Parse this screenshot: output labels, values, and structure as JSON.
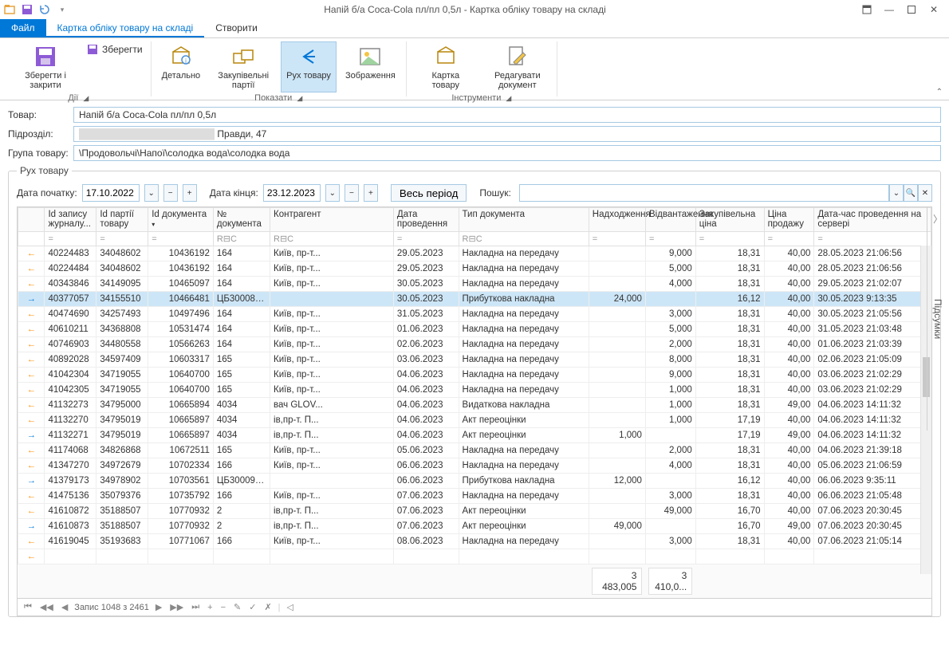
{
  "title": "Напій б/а Coca-Cola пл/пл 0,5л - Картка обліку товару на складі",
  "tabs": {
    "file": "Файл",
    "card": "Картка обліку товару на складі",
    "create": "Створити"
  },
  "ribbon": {
    "actions": {
      "label": "Дії",
      "save_close": "Зберегти і закрити",
      "save": "Зберегти"
    },
    "show": {
      "label": "Показати",
      "detail": "Детально",
      "batches": "Закупівельні партії",
      "movement": "Рух товару",
      "image": "Зображення"
    },
    "tools": {
      "label": "Інструменти",
      "card": "Картка товару",
      "edit": "Редагувати документ"
    }
  },
  "form": {
    "product_label": "Товар:",
    "product_value": "Напій б/а Coca-Cola пл/пл 0,5л",
    "division_label": "Підрозділ:",
    "division_value": "Правди, 47",
    "group_label": "Група товару:",
    "group_value": "\\Продовольчі\\Напої\\солодка вода\\солодка вода"
  },
  "panel": {
    "title": "Рух товару",
    "date_start_label": "Дата початку:",
    "date_start": "17.10.2022",
    "date_end_label": "Дата кінця:",
    "date_end": "23.12.2023",
    "whole_period": "Весь період",
    "search_label": "Пошук:"
  },
  "columns": [
    "",
    "Id запису журналу...",
    "Id партії товару",
    "Id документа",
    "№ документа",
    "Контрагент",
    "Дата проведення",
    "Тип документа",
    "Надходження",
    "Відвантаження",
    "Закупівельна ціна",
    "Ціна продажу",
    "Дата-час проведення на сервері"
  ],
  "filter_hints": [
    "",
    "=",
    "=",
    "=",
    "R⊟C",
    "R⊟C",
    "=",
    "R⊟C",
    "=",
    "=",
    "=",
    "=",
    "="
  ],
  "rows": [
    {
      "dir": "out",
      "jid": "40224483",
      "bid": "34048602",
      "did": "10436192",
      "dn": "164",
      "ctr": "Київ, пр-т...",
      "date": "29.05.2023",
      "type": "Накладна на передачу",
      "in": "",
      "out": "9,000",
      "pp": "18,31",
      "sp": "40,00",
      "srv": "28.05.2023 21:06:56"
    },
    {
      "dir": "out",
      "jid": "40224484",
      "bid": "34048602",
      "did": "10436192",
      "dn": "164",
      "ctr": "Київ, пр-т...",
      "date": "29.05.2023",
      "type": "Накладна на передачу",
      "in": "",
      "out": "5,000",
      "pp": "18,31",
      "sp": "40,00",
      "srv": "28.05.2023 21:06:56"
    },
    {
      "dir": "out",
      "jid": "40343846",
      "bid": "34149095",
      "did": "10465097",
      "dn": "164",
      "ctr": "Київ, пр-т...",
      "date": "30.05.2023",
      "type": "Накладна на передачу",
      "in": "",
      "out": "4,000",
      "pp": "18,31",
      "sp": "40,00",
      "srv": "29.05.2023 21:02:07"
    },
    {
      "dir": "in",
      "sel": true,
      "jid": "40377057",
      "bid": "34155510",
      "did": "10466481",
      "dn": "ЦБ300087...",
      "ctr": "",
      "date": "30.05.2023",
      "type": "Прибуткова накладна",
      "in": "24,000",
      "out": "",
      "pp": "16,12",
      "sp": "40,00",
      "srv": "30.05.2023 9:13:35"
    },
    {
      "dir": "out",
      "jid": "40474690",
      "bid": "34257493",
      "did": "10497496",
      "dn": "164",
      "ctr": "Київ, пр-т...",
      "date": "31.05.2023",
      "type": "Накладна на передачу",
      "in": "",
      "out": "3,000",
      "pp": "18,31",
      "sp": "40,00",
      "srv": "30.05.2023 21:05:56"
    },
    {
      "dir": "out",
      "jid": "40610211",
      "bid": "34368808",
      "did": "10531474",
      "dn": "164",
      "ctr": "Київ, пр-т...",
      "date": "01.06.2023",
      "type": "Накладна на передачу",
      "in": "",
      "out": "5,000",
      "pp": "18,31",
      "sp": "40,00",
      "srv": "31.05.2023 21:03:48"
    },
    {
      "dir": "out",
      "jid": "40746903",
      "bid": "34480558",
      "did": "10566263",
      "dn": "164",
      "ctr": "Київ, пр-т...",
      "date": "02.06.2023",
      "type": "Накладна на передачу",
      "in": "",
      "out": "2,000",
      "pp": "18,31",
      "sp": "40,00",
      "srv": "01.06.2023 21:03:39"
    },
    {
      "dir": "out",
      "jid": "40892028",
      "bid": "34597409",
      "did": "10603317",
      "dn": "165",
      "ctr": "Київ, пр-т...",
      "date": "03.06.2023",
      "type": "Накладна на передачу",
      "in": "",
      "out": "8,000",
      "pp": "18,31",
      "sp": "40,00",
      "srv": "02.06.2023 21:05:09"
    },
    {
      "dir": "out",
      "jid": "41042304",
      "bid": "34719055",
      "did": "10640700",
      "dn": "165",
      "ctr": "Київ, пр-т...",
      "date": "04.06.2023",
      "type": "Накладна на передачу",
      "in": "",
      "out": "9,000",
      "pp": "18,31",
      "sp": "40,00",
      "srv": "03.06.2023 21:02:29"
    },
    {
      "dir": "out",
      "jid": "41042305",
      "bid": "34719055",
      "did": "10640700",
      "dn": "165",
      "ctr": "Київ, пр-т...",
      "date": "04.06.2023",
      "type": "Накладна на передачу",
      "in": "",
      "out": "1,000",
      "pp": "18,31",
      "sp": "40,00",
      "srv": "03.06.2023 21:02:29"
    },
    {
      "dir": "out",
      "jid": "41132273",
      "bid": "34795000",
      "did": "10665894",
      "dn": "4034",
      "ctr": "вач GLOV...",
      "date": "04.06.2023",
      "type": "Видаткова накладна",
      "in": "",
      "out": "1,000",
      "pp": "18,31",
      "sp": "49,00",
      "srv": "04.06.2023 14:11:32"
    },
    {
      "dir": "out",
      "jid": "41132270",
      "bid": "34795019",
      "did": "10665897",
      "dn": "4034",
      "ctr": "ів,пр-т. П...",
      "date": "04.06.2023",
      "type": "Акт переоцінки",
      "in": "",
      "out": "1,000",
      "pp": "17,19",
      "sp": "40,00",
      "srv": "04.06.2023 14:11:32"
    },
    {
      "dir": "in",
      "jid": "41132271",
      "bid": "34795019",
      "did": "10665897",
      "dn": "4034",
      "ctr": "ів,пр-т. П...",
      "date": "04.06.2023",
      "type": "Акт переоцінки",
      "in": "1,000",
      "out": "",
      "pp": "17,19",
      "sp": "49,00",
      "srv": "04.06.2023 14:11:32"
    },
    {
      "dir": "out",
      "jid": "41174068",
      "bid": "34826868",
      "did": "10672511",
      "dn": "165",
      "ctr": "Київ, пр-т...",
      "date": "05.06.2023",
      "type": "Накладна на передачу",
      "in": "",
      "out": "2,000",
      "pp": "18,31",
      "sp": "40,00",
      "srv": "04.06.2023 21:39:18"
    },
    {
      "dir": "out",
      "jid": "41347270",
      "bid": "34972679",
      "did": "10702334",
      "dn": "166",
      "ctr": "Київ, пр-т...",
      "date": "06.06.2023",
      "type": "Накладна на передачу",
      "in": "",
      "out": "4,000",
      "pp": "18,31",
      "sp": "40,00",
      "srv": "05.06.2023 21:06:59"
    },
    {
      "dir": "in",
      "jid": "41379173",
      "bid": "34978902",
      "did": "10703561",
      "dn": "ЦБ300094...",
      "ctr": "",
      "date": "06.06.2023",
      "type": "Прибуткова накладна",
      "in": "12,000",
      "out": "",
      "pp": "16,12",
      "sp": "40,00",
      "srv": "06.06.2023 9:35:11"
    },
    {
      "dir": "out",
      "jid": "41475136",
      "bid": "35079376",
      "did": "10735792",
      "dn": "166",
      "ctr": "Київ, пр-т...",
      "date": "07.06.2023",
      "type": "Накладна на передачу",
      "in": "",
      "out": "3,000",
      "pp": "18,31",
      "sp": "40,00",
      "srv": "06.06.2023 21:05:48"
    },
    {
      "dir": "out",
      "jid": "41610872",
      "bid": "35188507",
      "did": "10770932",
      "dn": "2",
      "ctr": "ів,пр-т. П...",
      "date": "07.06.2023",
      "type": "Акт переоцінки",
      "in": "",
      "out": "49,000",
      "pp": "16,70",
      "sp": "40,00",
      "srv": "07.06.2023 20:30:45"
    },
    {
      "dir": "in",
      "jid": "41610873",
      "bid": "35188507",
      "did": "10770932",
      "dn": "2",
      "ctr": "ів,пр-т. П...",
      "date": "07.06.2023",
      "type": "Акт переоцінки",
      "in": "49,000",
      "out": "",
      "pp": "16,70",
      "sp": "49,00",
      "srv": "07.06.2023 20:30:45"
    },
    {
      "dir": "out",
      "jid": "41619045",
      "bid": "35193683",
      "did": "10771067",
      "dn": "166",
      "ctr": "Київ, пр-т...",
      "date": "08.06.2023",
      "type": "Накладна на передачу",
      "in": "",
      "out": "3,000",
      "pp": "18,31",
      "sp": "40,00",
      "srv": "07.06.2023 21:05:14"
    },
    {
      "dir": "out",
      "jid": "",
      "bid": "",
      "did": "",
      "dn": "",
      "ctr": "",
      "date": "",
      "type": "",
      "in": "",
      "out": "",
      "pp": "",
      "sp": "",
      "srv": ""
    }
  ],
  "footer": {
    "in_total": "3 483,005",
    "out_total": "3 410,0..."
  },
  "navigator": "Запис 1048 з 2461",
  "side_tab": "Підсумки"
}
